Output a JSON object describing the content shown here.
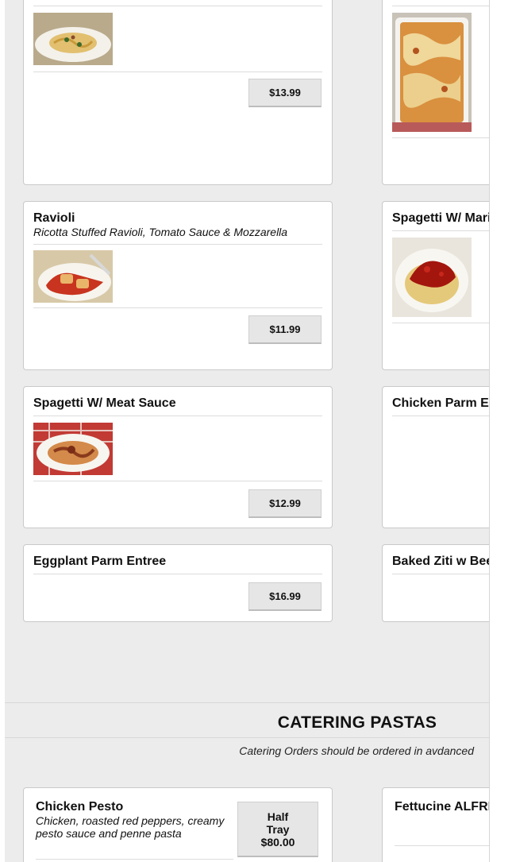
{
  "menu": {
    "pasta_items": [
      {
        "title": "",
        "description": "",
        "price": "$13.99"
      },
      {
        "title": "",
        "description": "",
        "price": ""
      },
      {
        "title": "Ravioli",
        "description": "Ricotta Stuffed Ravioli, Tomato Sauce & Mozzarella",
        "price": "$11.99"
      },
      {
        "title": "Spagetti W/ Mari",
        "description": "",
        "price": ""
      },
      {
        "title": "Spagetti W/ Meat Sauce",
        "description": "",
        "price": "$12.99"
      },
      {
        "title": "Chicken Parm E",
        "description": "",
        "price": ""
      },
      {
        "title": "Eggplant Parm Entree",
        "description": "",
        "price": "$16.99"
      },
      {
        "title": "Baked Ziti w Bee",
        "description": "",
        "price": ""
      }
    ]
  },
  "catering": {
    "section_title": "CATERING PASTAS",
    "note": "Catering Orders should be ordered in avdanced",
    "items": [
      {
        "title": "Chicken Pesto",
        "description_line1": "Chicken, roasted red peppers, creamy",
        "description_line2": "pesto sauce and penne pasta",
        "tray_line1": "Half",
        "tray_line2": "Tray",
        "tray_price": "$80.00"
      },
      {
        "title": "Fettucine ALFRE"
      }
    ]
  },
  "icons": {
    "pasta_plate": "food-photo",
    "baked_ziti": "food-photo"
  }
}
